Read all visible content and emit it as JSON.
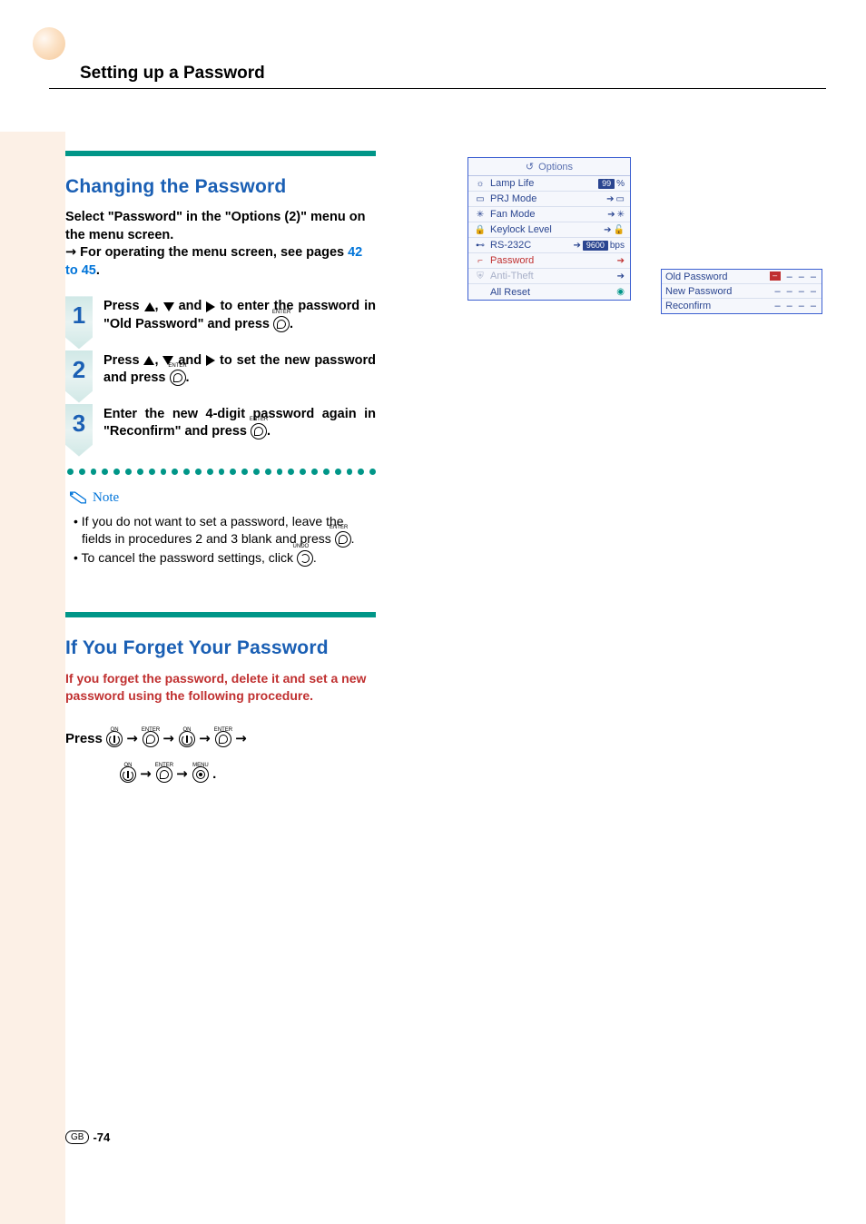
{
  "header": {
    "title": "Setting up a Password"
  },
  "section1": {
    "heading": "Changing the Password",
    "intro_a": "Select \"Password\" in the \"Options (2)\" menu on the menu screen.",
    "intro_b_prefix": "→",
    "intro_b": " For operating the menu screen, see pages ",
    "page_ref": "42 to 45",
    "intro_b_suffix": ".",
    "steps": [
      {
        "num": "1",
        "t1": "Press ",
        "t2": ", ",
        "t3": " and ",
        "t4": " to enter the password in \"Old Password\" and press ",
        "t5": "."
      },
      {
        "num": "2",
        "t1": "Press ",
        "t2": ", ",
        "t3": " and ",
        "t4": " to set the new password and press ",
        "t5": "."
      },
      {
        "num": "3",
        "t4": "Enter the new 4-digit password again in \"Reconfirm\" and press ",
        "t5": "."
      }
    ]
  },
  "note": {
    "label": "Note",
    "items": [
      {
        "a": "If you do not want to set a password, leave the fields in procedures 2 and 3 blank and press ",
        "b": "."
      },
      {
        "a": "To cancel the password settings, click ",
        "b": "."
      }
    ]
  },
  "section2": {
    "heading": "If You Forget Your Password",
    "intro": "If you forget the password, delete it and set a new password using the following procedure.",
    "press_label": "Press ",
    "seq_labels": {
      "on": "ON",
      "enter": "ENTER",
      "menu": "MENU",
      "undo": "UNDO"
    }
  },
  "options": {
    "title": "Options",
    "rows": {
      "lamp": {
        "label": "Lamp Life",
        "val": "99",
        "unit": "%"
      },
      "prj": {
        "label": "PRJ Mode"
      },
      "fan": {
        "label": "Fan Mode"
      },
      "keylock": {
        "label": "Keylock Level"
      },
      "rs232": {
        "label": "RS-232C",
        "val": "9600",
        "unit": "bps"
      },
      "password": {
        "label": "Password"
      },
      "anti": {
        "label": "Anti-Theft"
      },
      "reset": {
        "label": "All Reset"
      }
    }
  },
  "pwdbox": {
    "rows": [
      {
        "label": "Old Password",
        "cursor": true
      },
      {
        "label": "New Password",
        "cursor": false
      },
      {
        "label": "Reconfirm",
        "cursor": false
      }
    ]
  },
  "footer": {
    "region": "GB",
    "page": "-74"
  }
}
